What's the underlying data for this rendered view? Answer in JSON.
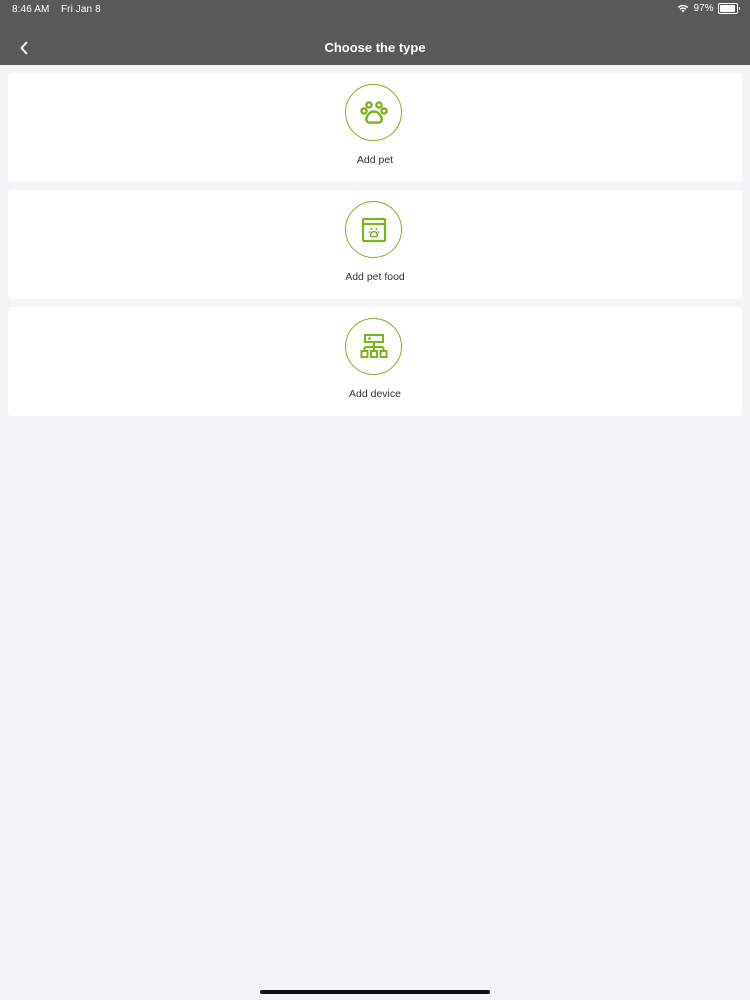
{
  "status_bar": {
    "time": "8:46 AM",
    "date": "Fri Jan 8",
    "battery": "97%",
    "battery_level": 0.97,
    "icons": [
      "wifi-icon",
      "battery-icon"
    ]
  },
  "nav": {
    "title": "Choose the type",
    "back_icon": "chevron-left-icon"
  },
  "options": [
    {
      "label": "Add pet",
      "icon": "paw-icon"
    },
    {
      "label": "Add pet food",
      "icon": "pet-food-bag-icon"
    },
    {
      "label": "Add device",
      "icon": "device-network-icon"
    }
  ],
  "colors": {
    "header_bg": "#595959",
    "page_bg": "#f5f5f7",
    "accent": "#7ab51d",
    "card_bg": "#ffffff",
    "label_text": "#333333"
  }
}
